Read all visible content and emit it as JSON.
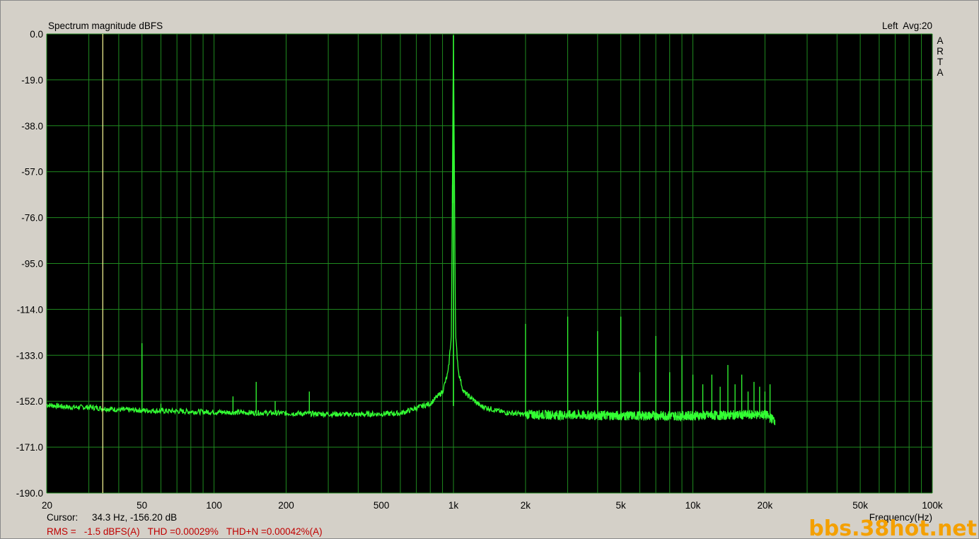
{
  "chart_data": {
    "type": "line",
    "title": "Spectrum magnitude dBFS",
    "channel_label": "Left  Avg:20",
    "brand_letters": [
      "A",
      "R",
      "T",
      "A"
    ],
    "xlabel": "Frequency(Hz)",
    "ylabel": "",
    "xscale": "log",
    "xlim": [
      20,
      100000
    ],
    "ylim": [
      -190,
      0
    ],
    "y_ticks": [
      0,
      -19,
      -38,
      -57,
      -76,
      -95,
      -114,
      -133,
      -152,
      -171,
      -190
    ],
    "y_tick_labels": [
      "0.0",
      "-19.0",
      "-38.0",
      "-57.0",
      "-76.0",
      "-95.0",
      "-114.0",
      "-133.0",
      "-152.0",
      "-171.0",
      "-190.0"
    ],
    "x_ticks": [
      20,
      50,
      100,
      200,
      500,
      1000,
      2000,
      5000,
      10000,
      20000,
      50000,
      100000
    ],
    "x_tick_labels": [
      "20",
      "50",
      "100",
      "200",
      "500",
      "1k",
      "2k",
      "5k",
      "10k",
      "20k",
      "50k",
      "100k"
    ],
    "grid": true,
    "colors": {
      "background": "#000000",
      "grid": "#1f8a1f",
      "trace": "#33ff33",
      "cursor": "#ffff99",
      "panel": "#d4d0c8",
      "readout": "#c00000"
    },
    "cursor": {
      "x": 34.3,
      "y": -156.2
    },
    "series": [
      {
        "noise_floor": [
          [
            20,
            -153.5
          ],
          [
            25,
            -154.5
          ],
          [
            30,
            -154.5
          ],
          [
            40,
            -155.5
          ],
          [
            60,
            -156
          ],
          [
            100,
            -156.5
          ],
          [
            200,
            -157
          ],
          [
            400,
            -157.5
          ],
          [
            600,
            -157
          ],
          [
            800,
            -153
          ],
          [
            900,
            -148
          ],
          [
            950,
            -140
          ],
          [
            980,
            -125
          ],
          [
            1000,
            -0.5
          ],
          [
            1020,
            -125
          ],
          [
            1050,
            -140
          ],
          [
            1100,
            -148
          ],
          [
            1300,
            -154
          ],
          [
            1600,
            -156.5
          ],
          [
            2000,
            -157.5
          ],
          [
            5000,
            -158
          ],
          [
            10000,
            -158
          ],
          [
            20000,
            -157.5
          ],
          [
            22000,
            -160
          ]
        ],
        "peaks": [
          {
            "x": 50,
            "y": -128
          },
          {
            "x": 60,
            "y": -153
          },
          {
            "x": 120,
            "y": -150
          },
          {
            "x": 150,
            "y": -144
          },
          {
            "x": 180,
            "y": -152
          },
          {
            "x": 250,
            "y": -148
          },
          {
            "x": 990,
            "y": -70
          },
          {
            "x": 2000,
            "y": -120
          },
          {
            "x": 3000,
            "y": -117
          },
          {
            "x": 4000,
            "y": -123
          },
          {
            "x": 5000,
            "y": -117
          },
          {
            "x": 6000,
            "y": -140
          },
          {
            "x": 7000,
            "y": -125
          },
          {
            "x": 8000,
            "y": -140
          },
          {
            "x": 9000,
            "y": -133
          },
          {
            "x": 10000,
            "y": -141
          },
          {
            "x": 11000,
            "y": -145
          },
          {
            "x": 12000,
            "y": -141
          },
          {
            "x": 13000,
            "y": -146
          },
          {
            "x": 14000,
            "y": -137
          },
          {
            "x": 15000,
            "y": -145
          },
          {
            "x": 16000,
            "y": -141
          },
          {
            "x": 17000,
            "y": -148
          },
          {
            "x": 18000,
            "y": -144
          },
          {
            "x": 19000,
            "y": -146
          },
          {
            "x": 20000,
            "y": -148
          },
          {
            "x": 21000,
            "y": -145
          }
        ]
      }
    ],
    "readout": {
      "cursor_label": "Cursor:",
      "cursor_value": "34.3 Hz, -156.20 dB",
      "rms_text": "RMS =   -1.5 dBFS(A)   THD =0.00029%   THD+N =0.00042%(A)"
    },
    "watermark": "bbs.38hot.net"
  }
}
